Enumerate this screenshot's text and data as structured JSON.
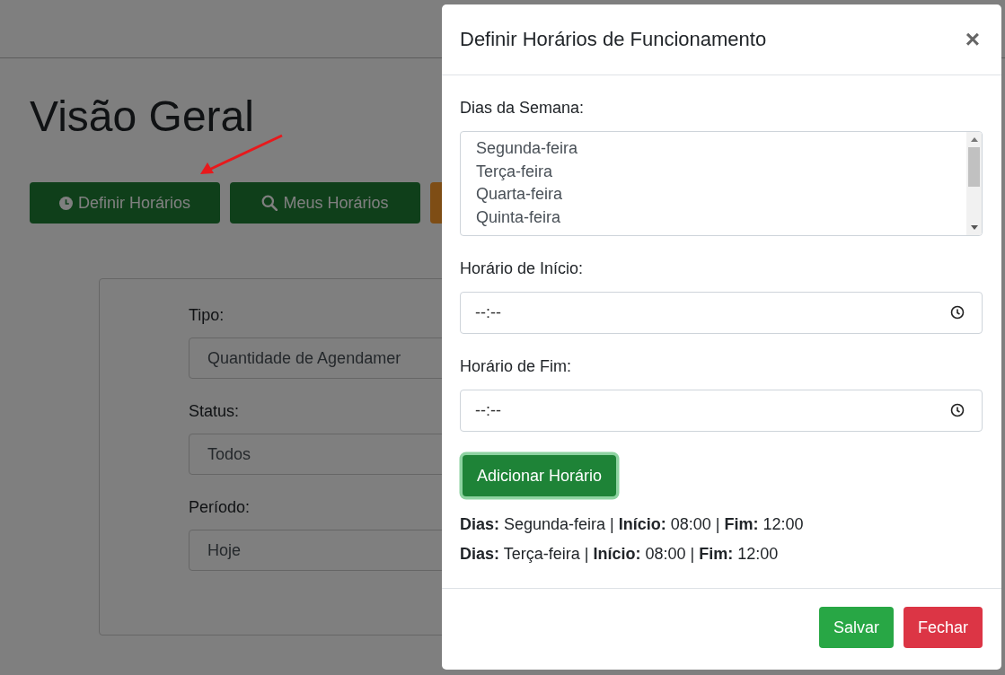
{
  "page": {
    "title": "Visão Geral",
    "buttons": [
      {
        "label": "Definir Horários",
        "kind": "clock"
      },
      {
        "label": "Meus Horários",
        "kind": "search"
      },
      {
        "kind": "plain"
      }
    ],
    "filters": [
      {
        "label": "Tipo:",
        "value": "Quantidade de Agendamer"
      },
      {
        "label": "Status:",
        "value": "Todos"
      },
      {
        "label": "Período:",
        "value": "Hoje"
      }
    ]
  },
  "modal": {
    "title": "Definir Horários de Funcionamento",
    "close": "×",
    "days_label": "Dias da Semana:",
    "days": [
      {
        "label": "Segunda-feira",
        "selected": false
      },
      {
        "label": "Terça-feira",
        "selected": false
      },
      {
        "label": "Quarta-feira",
        "selected": false
      },
      {
        "label": "Quinta-feira",
        "selected": false
      }
    ],
    "start_label": "Horário de Início:",
    "start": {
      "placeholder": "--:--"
    },
    "end_label": "Horário de Fim:",
    "end": {
      "placeholder": "--:--"
    },
    "add_button": "Adicionar Horário",
    "schedules": [
      "**Dias:** Segunda-feira | **Início:** 08:00 | **Fim:** 12:00",
      "**Dias:** Terça-feira | **Início:** 08:00 | **Fim:** 12:00"
    ],
    "footer_buttons": [
      {
        "label": "Salvar",
        "kind": "success"
      },
      {
        "label": "Fechar",
        "kind": "danger"
      }
    ]
  }
}
